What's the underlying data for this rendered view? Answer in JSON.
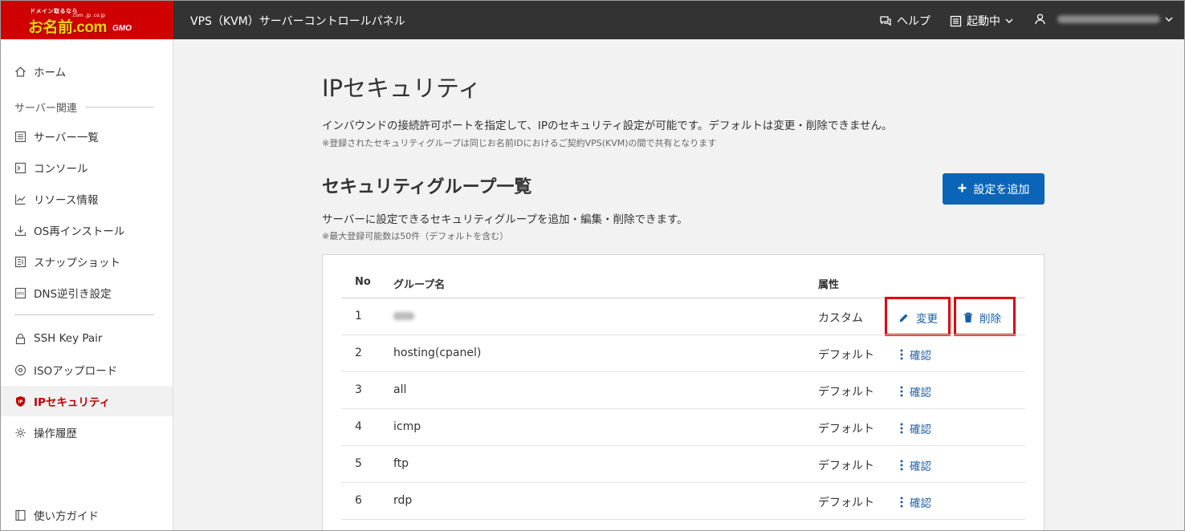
{
  "header": {
    "logo_tag": "ドメイン取るなら",
    "logo_sub": ".com .jp .co.jp",
    "logo_main": "お名前.com",
    "logo_gmo": "GMO",
    "app_title": "VPS（KVM）サーバーコントロールパネル",
    "help_label": "ヘルプ",
    "status_label": "起動中"
  },
  "sidebar": {
    "home": "ホーム",
    "section_label": "サーバー関連",
    "items": [
      {
        "label": "サーバー一覧",
        "icon": "server-list-icon"
      },
      {
        "label": "コンソール",
        "icon": "console-icon"
      },
      {
        "label": "リソース情報",
        "icon": "chart-icon"
      },
      {
        "label": "OS再インストール",
        "icon": "download-icon"
      },
      {
        "label": "スナップショット",
        "icon": "snapshot-icon"
      },
      {
        "label": "DNS逆引き設定",
        "icon": "dns-icon"
      }
    ],
    "items2": [
      {
        "label": "SSH Key Pair",
        "icon": "lock-icon"
      },
      {
        "label": "ISOアップロード",
        "icon": "disc-icon"
      },
      {
        "label": "IPセキュリティ",
        "icon": "shield-icon",
        "active": true
      },
      {
        "label": "操作履歴",
        "icon": "gear-icon"
      }
    ],
    "guide": "使い方ガイド"
  },
  "main": {
    "title": "IPセキュリティ",
    "description": "インバウンドの接続許可ポートを指定して、IPのセキュリティ設定が可能です。デフォルトは変更・削除できません。",
    "note": "※登録されたセキュリティグループは同じお名前IDにおけるご契約VPS(KVM)の間で共有となります",
    "section_title": "セキュリティグループ一覧",
    "add_button": "設定を追加",
    "section_desc": "サーバーに設定できるセキュリティグループを追加・編集・削除できます。",
    "section_note": "※最大登録可能数は50件（デフォルトを含む）",
    "table": {
      "headers": {
        "no": "No",
        "name": "グループ名",
        "attr": "属性"
      },
      "rows": [
        {
          "no": "1",
          "name": "",
          "attr": "カスタム"
        },
        {
          "no": "2",
          "name": "hosting(cpanel)",
          "attr": "デフォルト"
        },
        {
          "no": "3",
          "name": "all",
          "attr": "デフォルト"
        },
        {
          "no": "4",
          "name": "icmp",
          "attr": "デフォルト"
        },
        {
          "no": "5",
          "name": "ftp",
          "attr": "デフォルト"
        },
        {
          "no": "6",
          "name": "rdp",
          "attr": "デフォルト"
        }
      ],
      "edit_label": "変更",
      "delete_label": "削除",
      "confirm_label": "確認"
    }
  },
  "colors": {
    "brand_red": "#d10000",
    "header_bg": "#333333",
    "accent_blue": "#0a65b8",
    "link_blue": "#1a5fa8",
    "highlight_red": "#e00000"
  }
}
